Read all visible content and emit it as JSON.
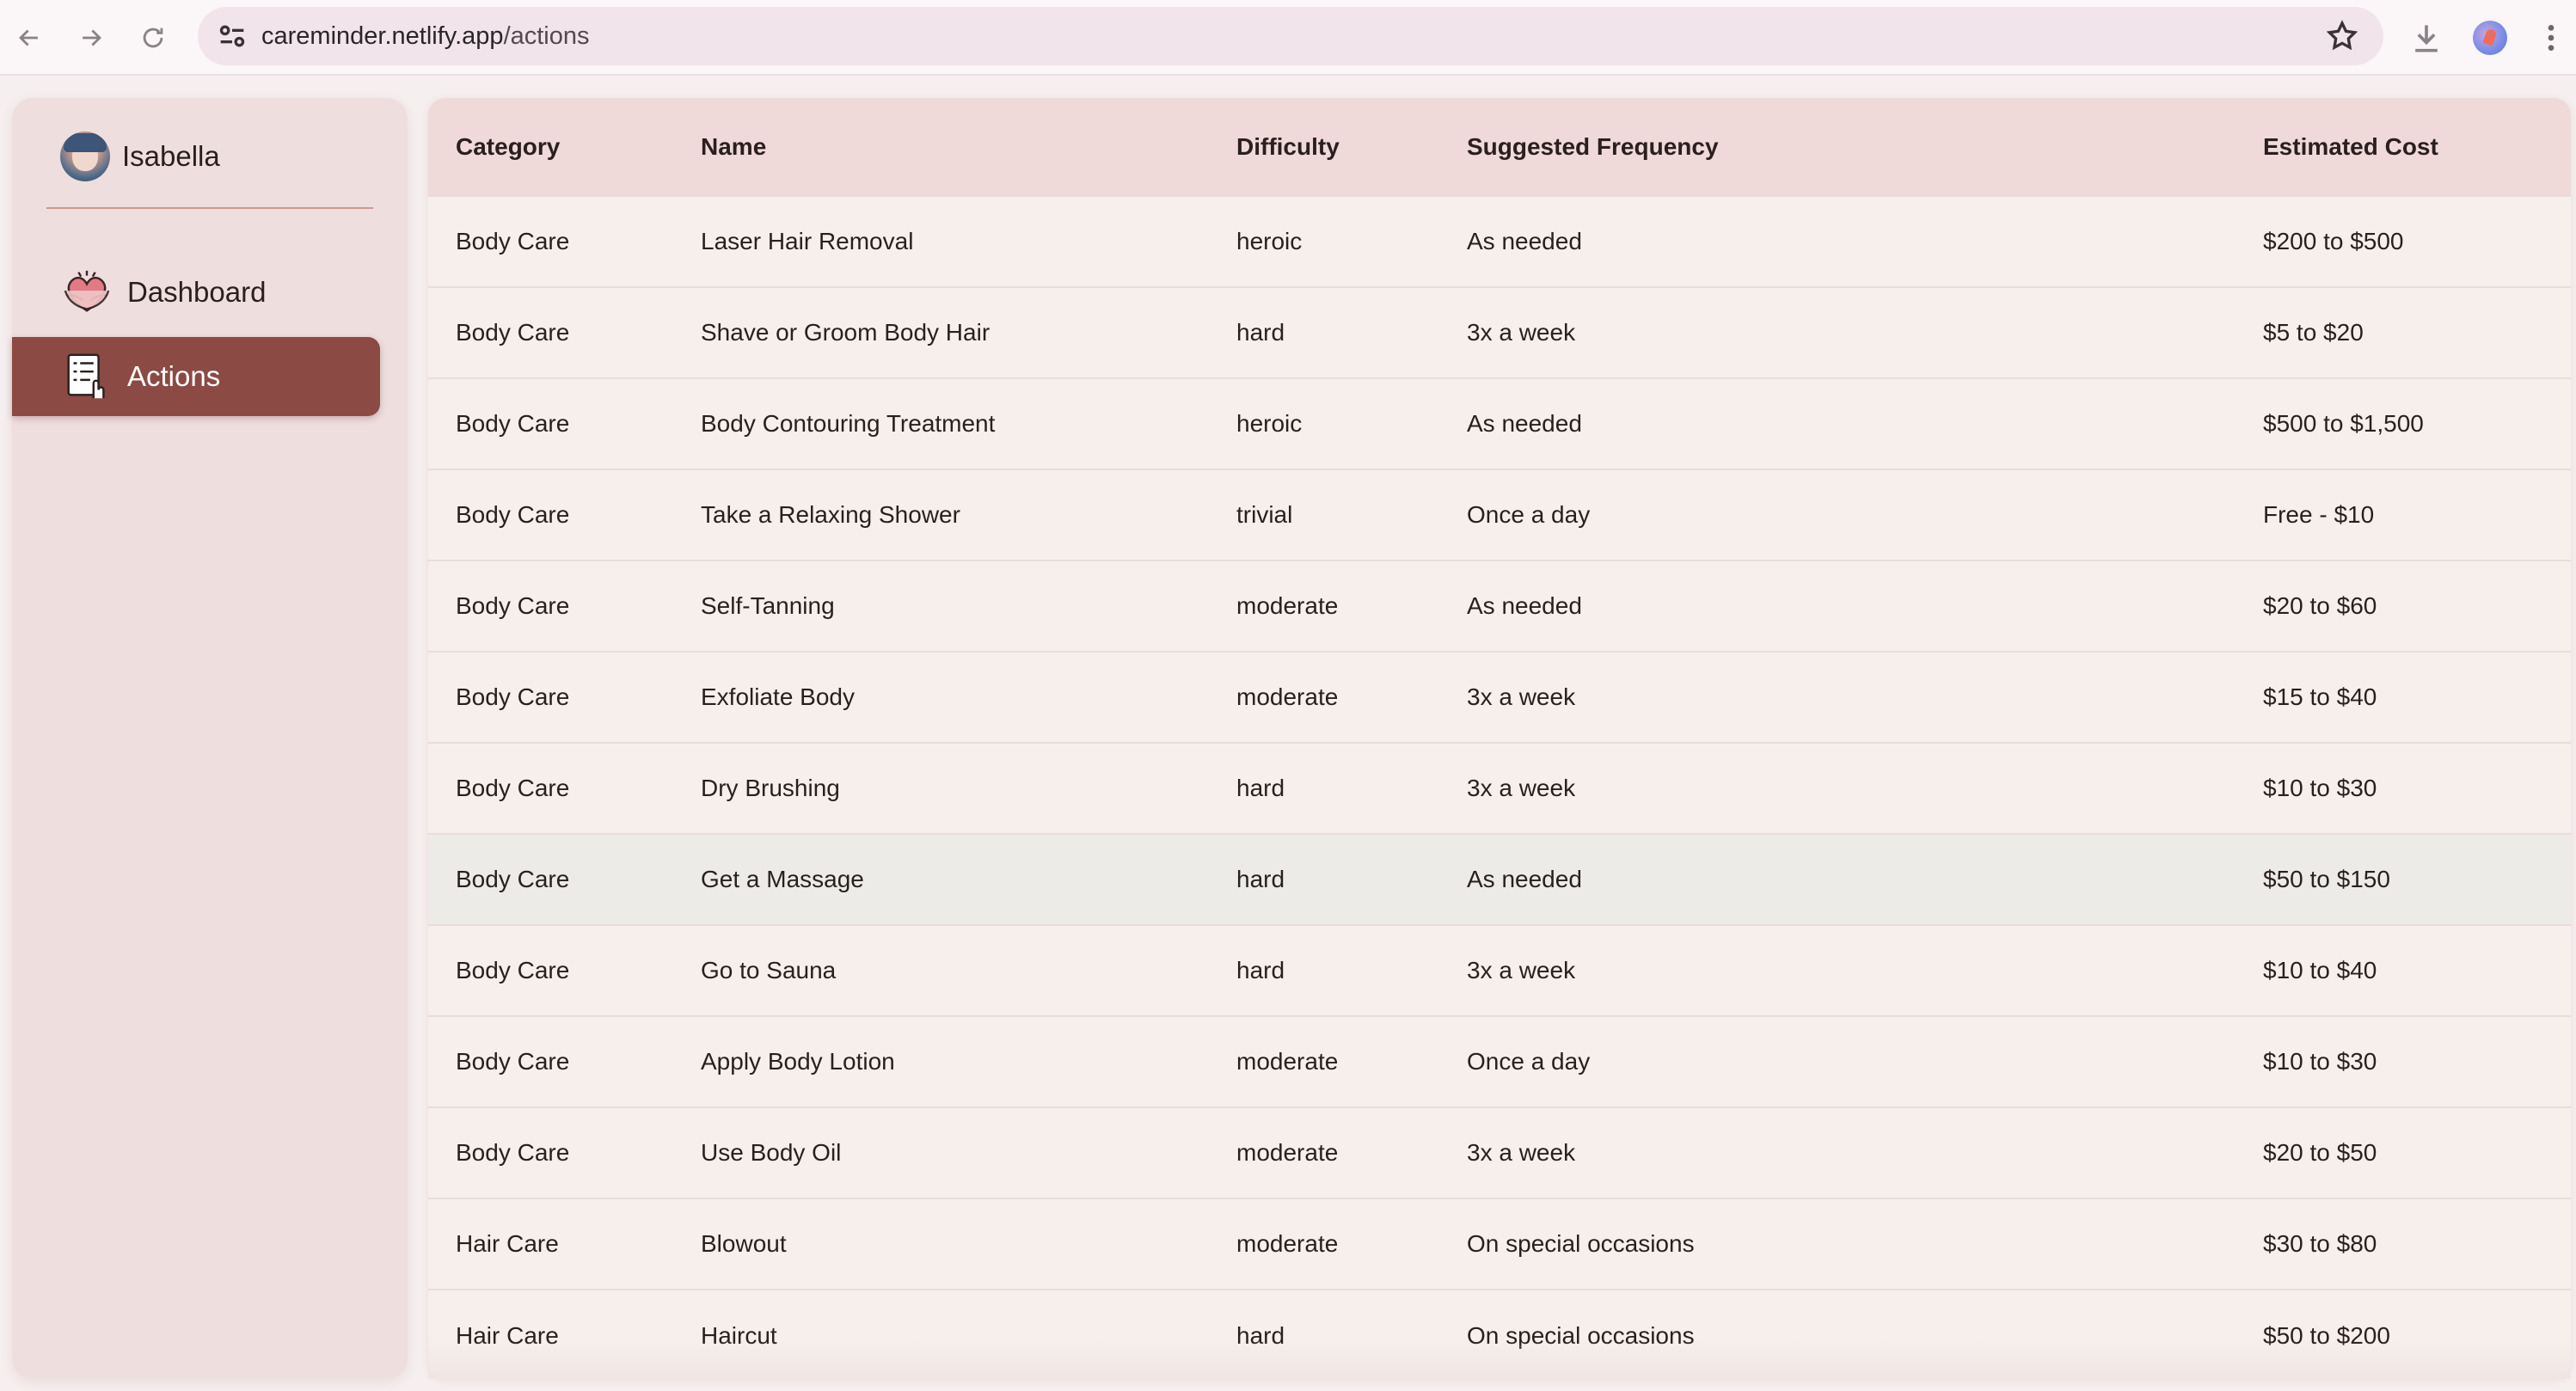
{
  "browser": {
    "url_host": "careminder.netlify.app",
    "url_path": "/actions"
  },
  "sidebar": {
    "user_name": "Isabella",
    "items": [
      {
        "label": "Dashboard",
        "icon": "heart-hands-icon",
        "active": false
      },
      {
        "label": "Actions",
        "icon": "checklist-icon",
        "active": true
      }
    ]
  },
  "table": {
    "headers": [
      "Category",
      "Name",
      "Difficulty",
      "Suggested Frequency",
      "Estimated Cost"
    ],
    "rows": [
      [
        "Body Care",
        "Laser Hair Removal",
        "heroic",
        "As needed",
        "$200 to $500"
      ],
      [
        "Body Care",
        "Shave or Groom Body Hair",
        "hard",
        "3x a week",
        "$5 to $20"
      ],
      [
        "Body Care",
        "Body Contouring Treatment",
        "heroic",
        "As needed",
        "$500 to $1,500"
      ],
      [
        "Body Care",
        "Take a Relaxing Shower",
        "trivial",
        "Once a day",
        "Free - $10"
      ],
      [
        "Body Care",
        "Self-Tanning",
        "moderate",
        "As needed",
        "$20 to $60"
      ],
      [
        "Body Care",
        "Exfoliate Body",
        "moderate",
        "3x a week",
        "$15 to $40"
      ],
      [
        "Body Care",
        "Dry Brushing",
        "hard",
        "3x a week",
        "$10 to $30"
      ],
      [
        "Body Care",
        "Get a Massage",
        "hard",
        "As needed",
        "$50 to $150"
      ],
      [
        "Body Care",
        "Go to Sauna",
        "hard",
        "3x a week",
        "$10 to $40"
      ],
      [
        "Body Care",
        "Apply Body Lotion",
        "moderate",
        "Once a day",
        "$10 to $30"
      ],
      [
        "Body Care",
        "Use Body Oil",
        "moderate",
        "3x a week",
        "$20 to $50"
      ],
      [
        "Hair Care",
        "Blowout",
        "moderate",
        "On special occasions",
        "$30 to $80"
      ],
      [
        "Hair Care",
        "Haircut",
        "hard",
        "On special occasions",
        "$50 to $200"
      ]
    ],
    "hovered_row": 7
  },
  "colors": {
    "accent": "#8b4a44",
    "sidebar_bg": "#efdede",
    "header_bg": "#efd9d9",
    "row_bg": "#f6efec"
  }
}
